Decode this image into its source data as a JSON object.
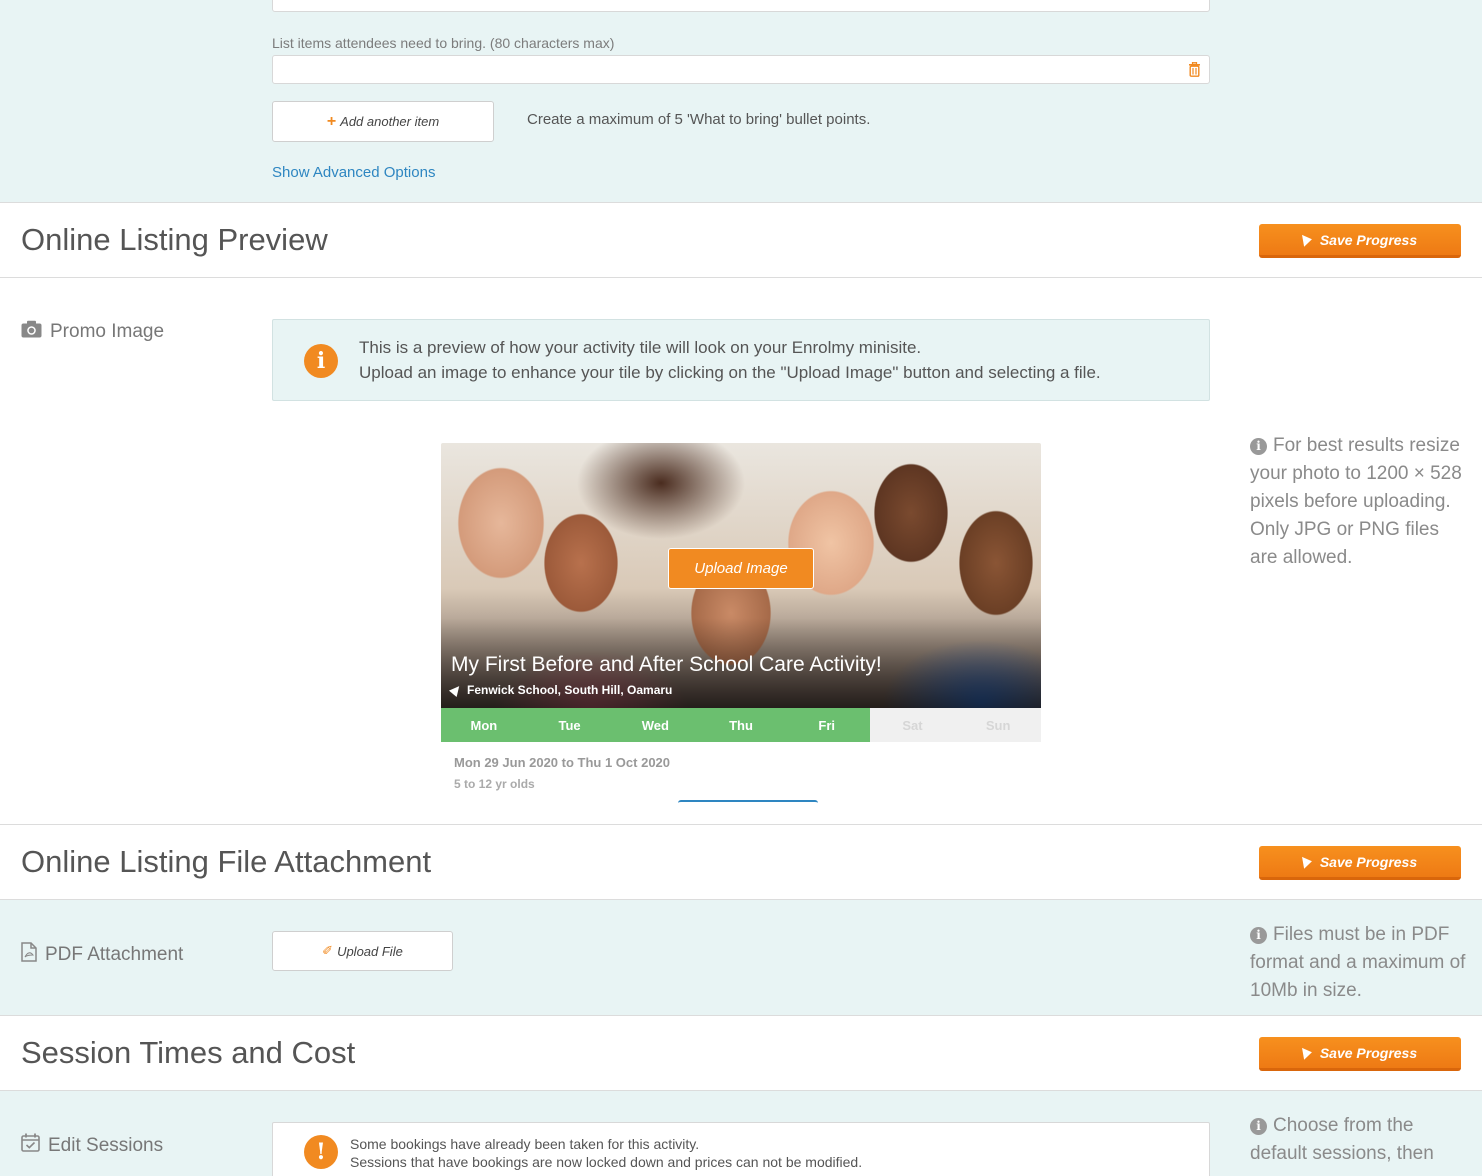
{
  "what_to_bring": {
    "label": "List items attendees need to bring. (80 characters max)",
    "input_value": "",
    "add_button_label": "Add another item",
    "hint": "Create a maximum of 5 'What to bring' bullet points.",
    "advanced_link": "Show Advanced Options"
  },
  "preview_section": {
    "title": "Online Listing Preview",
    "save_label": "Save Progress",
    "row_label": "Promo Image",
    "notice_line1": "This is a preview of how your activity tile will look on your Enrolmy minisite.",
    "notice_line2": "Upload an image to enhance your tile by clicking on the \"Upload Image\" button and selecting a file.",
    "side_note": "For best results resize your photo to 1200 × 528 pixels before uploading. Only JPG or PNG files are allowed."
  },
  "tile": {
    "upload_label": "Upload Image",
    "title": "My First Before and After School Care Activity!",
    "location": "Fenwick School, South Hill, Oamaru",
    "days": [
      {
        "label": "Mon",
        "active": true
      },
      {
        "label": "Tue",
        "active": true
      },
      {
        "label": "Wed",
        "active": true
      },
      {
        "label": "Thu",
        "active": true
      },
      {
        "label": "Fri",
        "active": true
      },
      {
        "label": "Sat",
        "active": false
      },
      {
        "label": "Sun",
        "active": false
      }
    ],
    "dates": "Mon 29 Jun 2020 to Thu 1 Oct 2020",
    "ages": "5 to 12 yr olds"
  },
  "attachment_section": {
    "title": "Online Listing File Attachment",
    "save_label": "Save Progress",
    "row_label": "PDF Attachment",
    "upload_label": "Upload File",
    "side_note": "Files must be in PDF format and a maximum of 10Mb in size."
  },
  "sessions_section": {
    "title": "Session Times and Cost",
    "save_label": "Save Progress",
    "row_label": "Edit Sessions",
    "warn_line1": "Some bookings have already been taken for this activity.",
    "warn_line2": "Sessions that have bookings are now locked down and prices can not be modified.",
    "side_note": "Choose from the default sessions, then"
  },
  "colors": {
    "accent": "#f18a21",
    "section_bg": "#e8f4f4",
    "day_active": "#6bbf6f",
    "link": "#2e86c1"
  }
}
